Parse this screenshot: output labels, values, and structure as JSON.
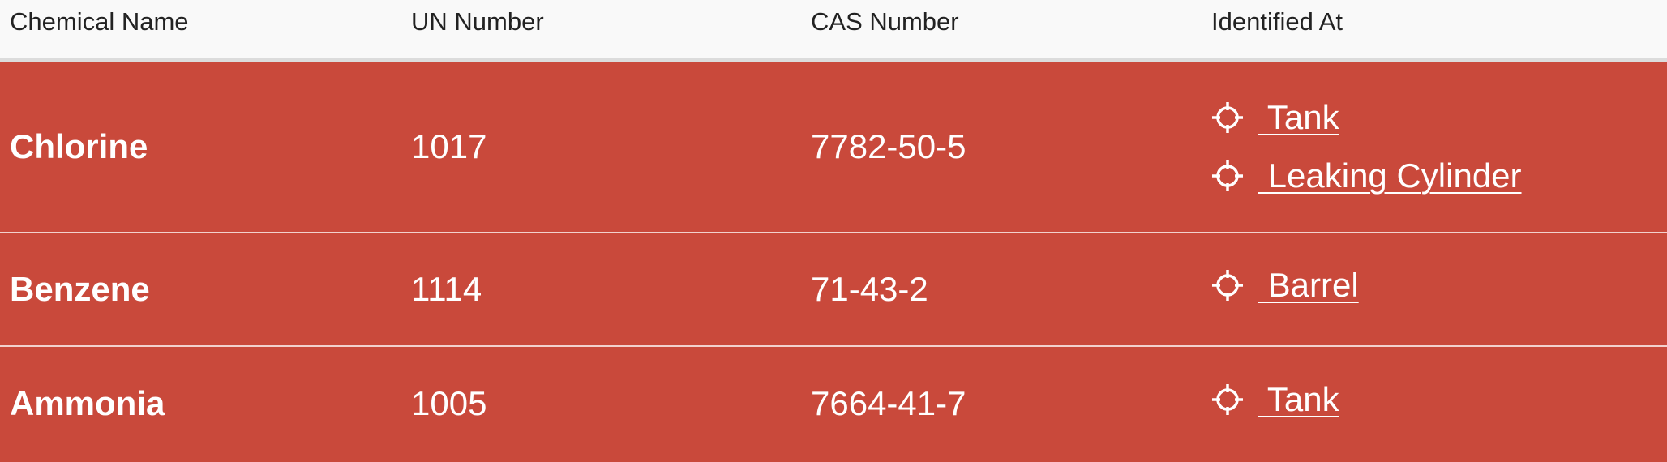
{
  "colors": {
    "row_background": "#c9493b",
    "header_background": "#f9f9f9",
    "text_on_row": "#ffffff"
  },
  "headers": {
    "chemical_name": "Chemical Name",
    "un_number": "UN Number",
    "cas_number": "CAS Number",
    "identified_at": "Identified At"
  },
  "rows": [
    {
      "name": "Chlorine",
      "un": "1017",
      "cas": "7782-50-5",
      "locations": [
        {
          "icon": "crosshair-icon",
          "label": " Tank"
        },
        {
          "icon": "crosshair-icon",
          "label": " Leaking Cylinder"
        }
      ]
    },
    {
      "name": "Benzene",
      "un": "1114",
      "cas": "71-43-2",
      "locations": [
        {
          "icon": "crosshair-icon",
          "label": " Barrel"
        }
      ]
    },
    {
      "name": "Ammonia",
      "un": "1005",
      "cas": "7664-41-7",
      "locations": [
        {
          "icon": "crosshair-icon",
          "label": " Tank"
        }
      ]
    }
  ]
}
